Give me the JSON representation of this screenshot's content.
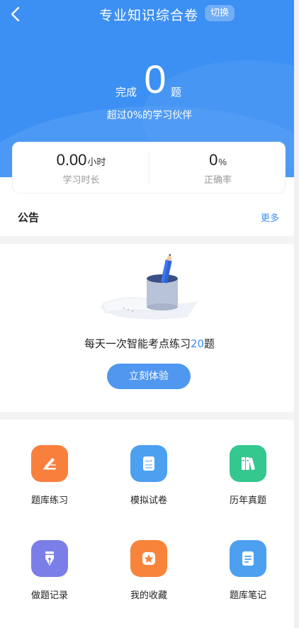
{
  "header": {
    "title": "专业知识综合卷",
    "switch_label": "切换"
  },
  "progress": {
    "prefix": "完成",
    "count": "0",
    "suffix": "题",
    "beat_text": "超过0%的学习伙伴"
  },
  "stats": {
    "study_time_value": "0.00",
    "study_time_unit": "小时",
    "study_time_label": "学习时长",
    "accuracy_value": "0",
    "accuracy_unit": "%",
    "accuracy_label": "正确率"
  },
  "notice": {
    "title": "公告",
    "more": "更多"
  },
  "daily": {
    "text_before": "每天一次智能考点练习",
    "count": "20",
    "text_after": "题",
    "button": "立刻体验"
  },
  "features": [
    {
      "label": "题库练习",
      "icon": "pen-paper-icon",
      "color": "#f97f3d"
    },
    {
      "label": "模拟试卷",
      "icon": "test-paper-icon",
      "color": "#4d9ff0"
    },
    {
      "label": "历年真题",
      "icon": "books-icon",
      "color": "#34c78e"
    },
    {
      "label": "做题记录",
      "icon": "fountain-pen-icon",
      "color": "#7b7ee9"
    },
    {
      "label": "我的收藏",
      "icon": "star-icon",
      "color": "#f7843a"
    },
    {
      "label": "题库笔记",
      "icon": "note-icon",
      "color": "#4d9ff0"
    }
  ],
  "colors": {
    "primary": "#3c8ff3",
    "button": "#4f97ef"
  }
}
